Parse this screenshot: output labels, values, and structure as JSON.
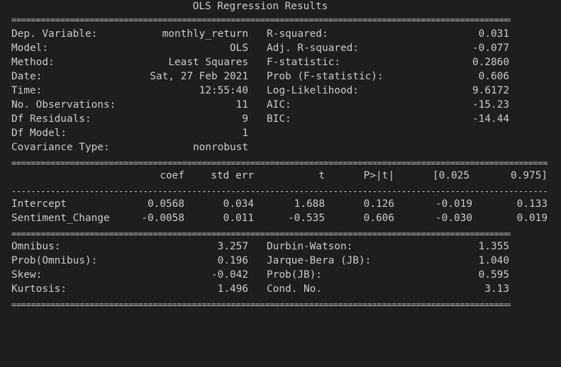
{
  "title": "OLS Regression Results",
  "top_table": {
    "left": [
      {
        "label": "Dep. Variable:",
        "value": "monthly_return"
      },
      {
        "label": "Model:",
        "value": "OLS"
      },
      {
        "label": "Method:",
        "value": "Least Squares"
      },
      {
        "label": "Date:",
        "value": "Sat, 27 Feb 2021"
      },
      {
        "label": "Time:",
        "value": "12:55:40"
      },
      {
        "label": "No. Observations:",
        "value": "11"
      },
      {
        "label": "Df Residuals:",
        "value": "9"
      },
      {
        "label": "Df Model:",
        "value": "1"
      },
      {
        "label": "Covariance Type:",
        "value": "nonrobust"
      }
    ],
    "right": [
      {
        "label": "R-squared:",
        "value": "0.031"
      },
      {
        "label": "Adj. R-squared:",
        "value": "-0.077"
      },
      {
        "label": "F-statistic:",
        "value": "0.2860"
      },
      {
        "label": "Prob (F-statistic):",
        "value": "0.606"
      },
      {
        "label": "Log-Likelihood:",
        "value": "9.6172"
      },
      {
        "label": "AIC:",
        "value": "-15.23"
      },
      {
        "label": "BIC:",
        "value": "-14.44"
      }
    ]
  },
  "coef_table": {
    "headers": [
      "coef",
      "std err",
      "t",
      "P>|t|",
      "[0.025",
      "0.975]"
    ],
    "rows": [
      {
        "name": "Intercept",
        "values": [
          "0.0568",
          "0.034",
          "1.688",
          "0.126",
          "-0.019",
          "0.133"
        ]
      },
      {
        "name": "Sentiment_Change",
        "values": [
          "-0.0058",
          "0.011",
          "-0.535",
          "0.606",
          "-0.030",
          "0.019"
        ]
      }
    ]
  },
  "diag_table": {
    "left": [
      {
        "label": "Omnibus:",
        "value": "3.257"
      },
      {
        "label": "Prob(Omnibus):",
        "value": "0.196"
      },
      {
        "label": "Skew:",
        "value": "-0.042"
      },
      {
        "label": "Kurtosis:",
        "value": "1.496"
      }
    ],
    "right": [
      {
        "label": "Durbin-Watson:",
        "value": "1.355"
      },
      {
        "label": "Jarque-Bera (JB):",
        "value": "1.040"
      },
      {
        "label": "Prob(JB):",
        "value": "0.595"
      },
      {
        "label": "Cond. No.",
        "value": "3.13"
      }
    ]
  },
  "colors": {
    "background": "#1e1e1e",
    "text": "#cccccc"
  }
}
